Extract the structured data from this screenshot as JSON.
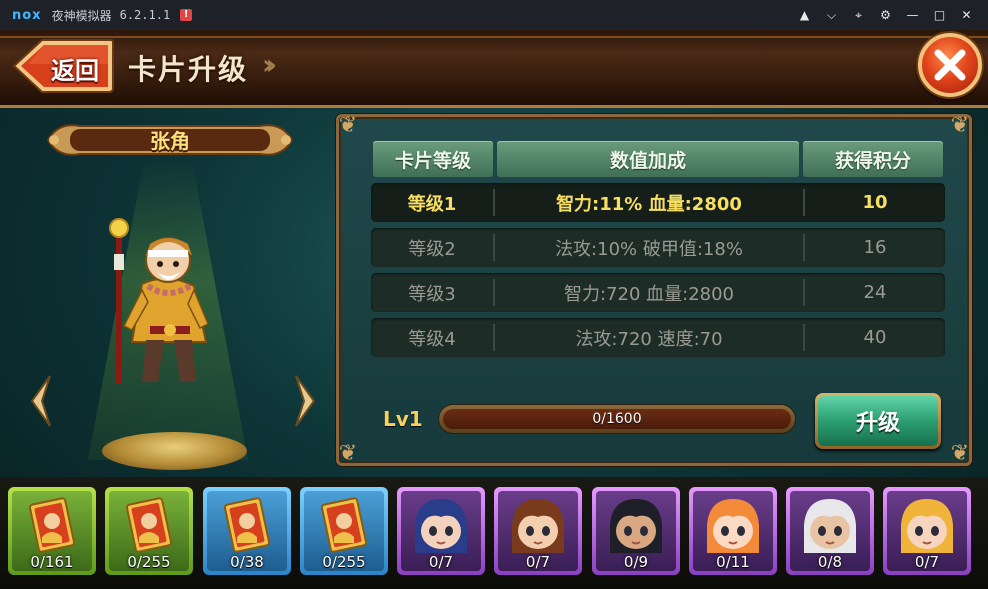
{
  "emulator": {
    "logo": "nox",
    "title": "夜神模拟器",
    "version": "6.2.1.1",
    "alert": "!",
    "icons": [
      "shirt-icon",
      "chevron-down-icon",
      "pin-icon",
      "gear-icon",
      "minimize-icon",
      "maximize-icon",
      "close-icon"
    ]
  },
  "header": {
    "back_label": "返回",
    "title": "卡片升级"
  },
  "character": {
    "name": "张角"
  },
  "table": {
    "headers": [
      "卡片等级",
      "数值加成",
      "获得积分"
    ],
    "rows": [
      {
        "level": "等级1",
        "bonus": "智力:11% 血量:2800",
        "points": "10",
        "active": true
      },
      {
        "level": "等级2",
        "bonus": "法攻:10% 破甲值:18%",
        "points": "16",
        "active": false
      },
      {
        "level": "等级3",
        "bonus": "智力:720 血量:2800",
        "points": "24",
        "active": false
      },
      {
        "level": "等级4",
        "bonus": "法攻:720 速度:70",
        "points": "40",
        "active": false
      }
    ]
  },
  "progress": {
    "level_label": "Lv1",
    "text": "0/1600",
    "current": 0,
    "max": 1600
  },
  "upgrade_label": "升级",
  "cards": [
    {
      "count": "0/161",
      "frame": "green",
      "kind": "card-item"
    },
    {
      "count": "0/255",
      "frame": "green",
      "kind": "card-item"
    },
    {
      "count": "0/38",
      "frame": "blue",
      "kind": "card-item"
    },
    {
      "count": "0/255",
      "frame": "blue",
      "kind": "card-item"
    },
    {
      "count": "0/7",
      "frame": "purple",
      "kind": "hero",
      "hair": "#2a3d8a",
      "skin": "#f3d2bd"
    },
    {
      "count": "0/7",
      "frame": "purple",
      "kind": "hero",
      "hair": "#7a3a1c",
      "skin": "#f3cfb0"
    },
    {
      "count": "0/9",
      "frame": "purple",
      "kind": "hero",
      "hair": "#1f1f2a",
      "skin": "#d9a882"
    },
    {
      "count": "0/11",
      "frame": "purple",
      "kind": "hero",
      "hair": "#f28a3a",
      "skin": "#fbd9c2"
    },
    {
      "count": "0/8",
      "frame": "purple",
      "kind": "hero",
      "hair": "#e8e8ea",
      "skin": "#e9c4a4"
    },
    {
      "count": "0/7",
      "frame": "purple",
      "kind": "hero",
      "hair": "#f0b43a",
      "skin": "#f7d4bd"
    }
  ]
}
